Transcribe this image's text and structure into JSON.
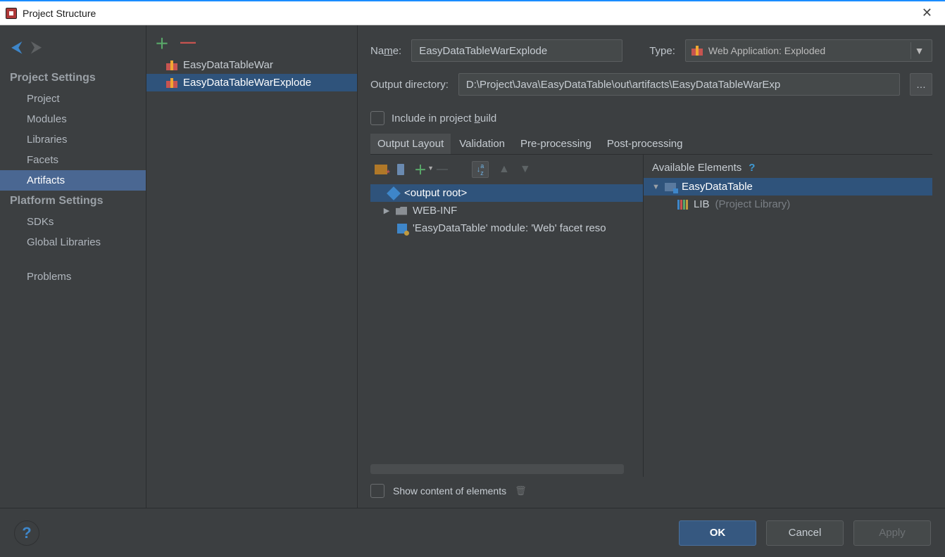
{
  "window": {
    "title": "Project Structure"
  },
  "sidebar": {
    "sections": [
      {
        "title": "Project Settings",
        "items": [
          {
            "label": "Project"
          },
          {
            "label": "Modules"
          },
          {
            "label": "Libraries"
          },
          {
            "label": "Facets"
          },
          {
            "label": "Artifacts",
            "selected": true
          }
        ]
      },
      {
        "title": "Platform Settings",
        "items": [
          {
            "label": "SDKs"
          },
          {
            "label": "Global Libraries"
          }
        ]
      },
      {
        "title": "",
        "items": [
          {
            "label": "Problems"
          }
        ]
      }
    ]
  },
  "artifacts": {
    "items": [
      {
        "label": "EasyDataTableWar"
      },
      {
        "label": "EasyDataTableWarExplode",
        "selected": true
      }
    ]
  },
  "detail": {
    "name_label_pre": "Na",
    "name_label_u": "m",
    "name_label_post": "e:",
    "name_value": "EasyDataTableWarExplode",
    "type_label": "Type:",
    "type_value": "Web Application: Exploded",
    "outdir_label": "Output directory:",
    "outdir_value": "D:\\Project\\Java\\EasyDataTable\\out\\artifacts\\EasyDataTableWarExp",
    "include_label_pre": "Include in project ",
    "include_label_u": "b",
    "include_label_post": "uild",
    "tabs": [
      {
        "label": "Output Layout",
        "active": true
      },
      {
        "label": "Validation"
      },
      {
        "label": "Pre-processing"
      },
      {
        "label": "Post-processing"
      }
    ],
    "output_tree": {
      "root_label": "<output root>",
      "children": [
        {
          "label": "WEB-INF",
          "kind": "folder"
        },
        {
          "label": "'EasyDataTable' module: 'Web' facet reso",
          "kind": "webfacet"
        }
      ]
    },
    "available": {
      "header": "Available Elements",
      "project": "EasyDataTable",
      "lib_label": "LIB",
      "lib_note": "(Project Library)"
    },
    "show_content_label": "Show content of elements"
  },
  "buttons": {
    "ok": "OK",
    "cancel": "Cancel",
    "apply": "Apply"
  }
}
